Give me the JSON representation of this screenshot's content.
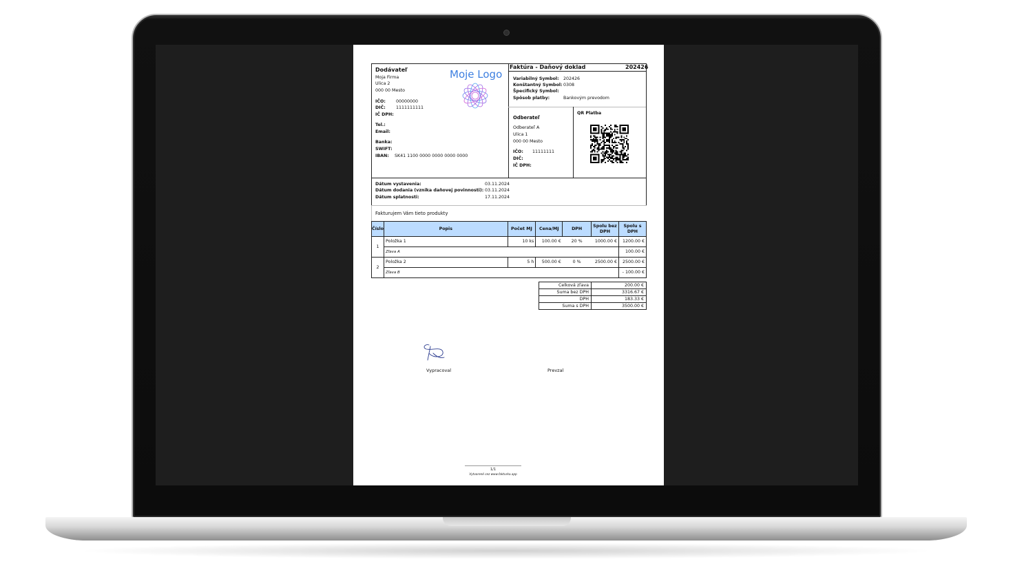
{
  "invoice": {
    "supplier": {
      "heading": "Dodávateľ",
      "name": "Moja Firma",
      "street": "Ulica 2",
      "city": "000 00 Mesto",
      "ico_label": "IČO:",
      "ico": "00000000",
      "dic_label": "DIČ:",
      "dic": "1111111111",
      "icdph_label": "IČ DPH:",
      "tel_label": "Tel.:",
      "email_label": "Email:",
      "bank_label": "Banka:",
      "swift_label": "SWIFT:",
      "iban_label": "IBAN:",
      "iban": "SK41 1100 0000 0000 0000 0000"
    },
    "logo_text": "Moje Logo",
    "title": "Faktúra - Daňový doklad",
    "number": "202426",
    "symbols": {
      "variable_label": "Variabilný Symbol:",
      "variable": "202426",
      "constant_label": "Konštantný Symbol:",
      "constant": "0308",
      "specific_label": "Špecifický Symbol:",
      "payment_label": "Spôsob platby:",
      "payment": "Bankovým prevodom"
    },
    "customer": {
      "heading": "Odberateľ",
      "name": "Odberateľ A",
      "street": "Ulica 1",
      "city": "000 00 Mesto",
      "ico_label": "IČO:",
      "ico": "11111111",
      "dic_label": "DIČ:",
      "icdph_label": "IČ DPH:"
    },
    "qr_label": "QR Platba",
    "dates": {
      "issued_label": "Dátum vystavenia:",
      "issued": "03.11.2024",
      "delivered_label": "Dátum dodania (vznika daňovej povinnosti):",
      "delivered": "03.11.2024",
      "due_label": "Dátum splatnosti:",
      "due": "17.11.2024"
    },
    "intro": "Fakturujem Vám tieto produkty",
    "table_headers": [
      "Číslo",
      "Popis",
      "Počet MJ",
      "Cena/MJ",
      "DPH",
      "Spolu bez DPH",
      "Spolu s DPH"
    ],
    "items": [
      {
        "no": "1",
        "desc": "Položka 1",
        "qty": "10 ks",
        "price": "100.00 €",
        "vat": "20 %",
        "net": "1000.00 €",
        "gross": "1200.00 €",
        "discount_label": "Zľava A",
        "discount": "100.00 €"
      },
      {
        "no": "2",
        "desc": "Položka 2",
        "qty": "5 h",
        "price": "500.00 €",
        "vat": "0 %",
        "net": "2500.00 €",
        "gross": "2500.00 €",
        "discount_label": "Zľava B",
        "discount": "- 100.00 €"
      }
    ],
    "totals": [
      {
        "label": "Celková zľava",
        "value": "200.00 €"
      },
      {
        "label": "Suma bez DPH",
        "value": "3316.67 €"
      },
      {
        "label": "DPH",
        "value": "183.33 €"
      },
      {
        "label": "Suma s DPH",
        "value": "3500.00 €"
      }
    ],
    "signed_by": "Vypracoval",
    "received_by": "Prevzal",
    "page_number": "1/1",
    "footer": "Vytvorené cez www.fakturka.app"
  }
}
